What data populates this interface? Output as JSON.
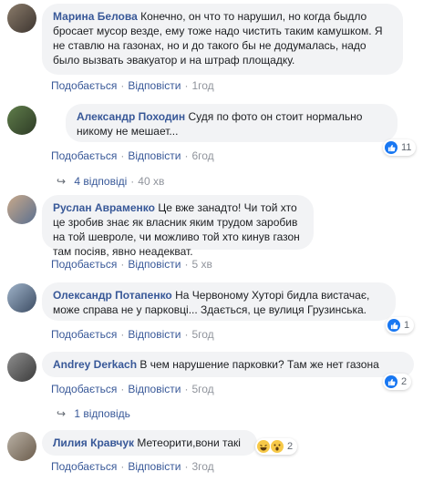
{
  "comments": [
    {
      "author": "Марина Белова",
      "text": "Конечно, он что то нарушил, но когда быдло бросает мусор везде, ему тоже надо чистить таким камушком. Я не ставлю на газонах, но и до такого бы не додумалась, надо было вызвать эвакуатор и на штраф площадку.",
      "like": "Подобається",
      "reply": "Відповісти",
      "time": "1год"
    },
    {
      "author": "Александр Походин",
      "text": "Судя по фото он стоит нормально никому не мешает...",
      "like": "Подобається",
      "reply": "Відповісти",
      "time": "6год",
      "reaction_count": "11",
      "reaction_icon": "like-icon",
      "replies_label": "4 відповіді",
      "replies_time": "40 хв"
    },
    {
      "author": "Руслан Авраменко",
      "text": "Це вже занадто! Чи той хто це зробив знає як власник яким трудом заробив на той шевроле, чи можливо той хто кинув газон там посіяв, явно неадекват.",
      "like": "Подобається",
      "reply": "Відповісти",
      "time": "5 хв"
    },
    {
      "author": "Олександр Потапенко",
      "text": "На Червоному Хуторі бидла вистачає, може справа не у парковці... Здається, це вулиця Грузинська.",
      "like": "Подобається",
      "reply": "Відповісти",
      "time": "5год",
      "reaction_count": "1",
      "reaction_icon": "like-icon"
    },
    {
      "author": "Andrey Derkach",
      "text": "В чем нарушение парковки? Там же нет газона",
      "like": "Подобається",
      "reply": "Відповісти",
      "time": "5год",
      "reaction_count": "2",
      "reaction_icon": "like-icon",
      "replies_label": "1 відповідь"
    },
    {
      "author": "Лилия Кравчук",
      "text": "Метеорити,вони такі",
      "like": "Подобається",
      "reply": "Відповісти",
      "time": "3год",
      "reaction_count": "2",
      "reaction_icon": "haha-wow-icon"
    }
  ],
  "colors": {
    "link": "#385898",
    "bubble": "#f2f3f5",
    "like_blue": "#1877f2"
  }
}
